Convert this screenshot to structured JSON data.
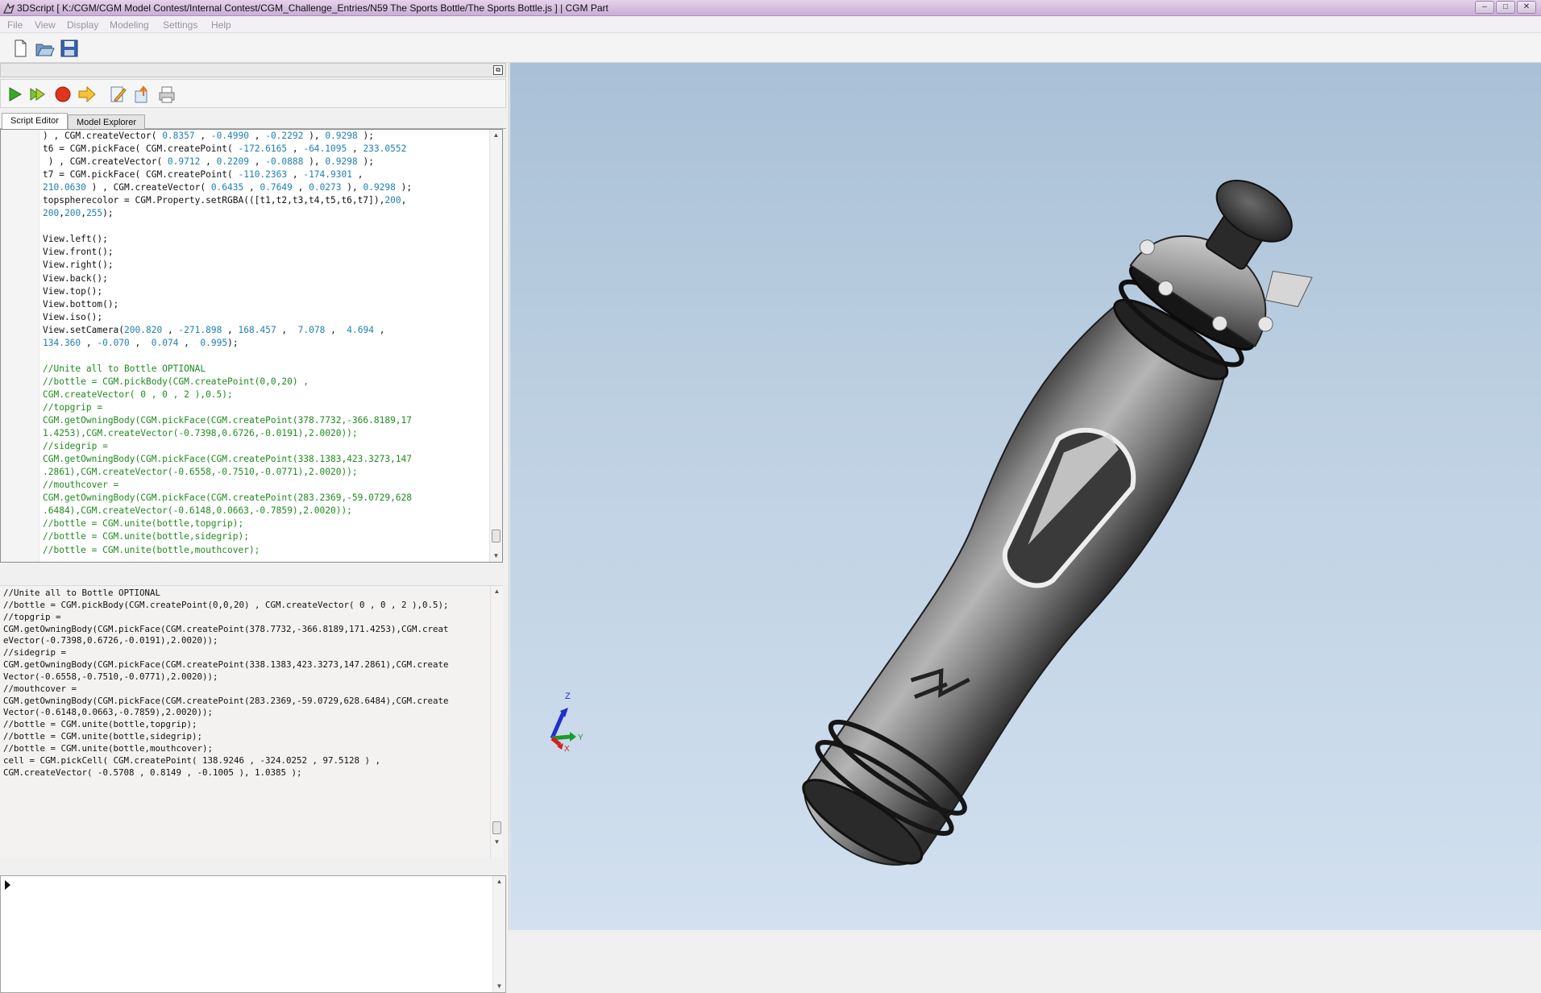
{
  "window": {
    "title": "3DScript [ K:/CGM/CGM Model Contest/Internal Contest/CGM_Challenge_Entries/N59 The Sports Bottle/The Sports Bottle.js ] | CGM Part",
    "buttons": [
      "–",
      "□",
      "✕"
    ]
  },
  "menu": [
    "File",
    "View",
    "Display",
    "Modeling",
    "Settings",
    "Help"
  ],
  "toolbar": {
    "icons": [
      "new-file-icon",
      "open-folder-icon",
      "save-icon"
    ]
  },
  "script_toolbar": {
    "icons": [
      "run-icon",
      "run-step-icon",
      "stop-icon",
      "forward-arrow-icon",
      "edit-script-icon",
      "export-icon",
      "print-icon"
    ]
  },
  "tabs": [
    "Script Editor",
    "Model Explorer"
  ],
  "editor_lines": [
    [
      [
        "k",
        ") , CGM.createVector( "
      ],
      [
        "n",
        "0.8357"
      ],
      [
        "k",
        " , "
      ],
      [
        "n",
        "-0.4990"
      ],
      [
        "k",
        " , "
      ],
      [
        "n",
        "-0.2292"
      ],
      [
        "k",
        " ), "
      ],
      [
        "n",
        "0.9298"
      ],
      [
        "k",
        " );"
      ]
    ],
    [
      [
        "k",
        "t6 = CGM.pickFace( CGM.createPoint( "
      ],
      [
        "n",
        "-172.6165"
      ],
      [
        "k",
        " , "
      ],
      [
        "n",
        "-64.1095"
      ],
      [
        "k",
        " , "
      ],
      [
        "n",
        "233.0552"
      ]
    ],
    [
      [
        "k",
        " ) , CGM.createVector( "
      ],
      [
        "n",
        "0.9712"
      ],
      [
        "k",
        " , "
      ],
      [
        "n",
        "0.2209"
      ],
      [
        "k",
        " , "
      ],
      [
        "n",
        "-0.0888"
      ],
      [
        "k",
        " ), "
      ],
      [
        "n",
        "0.9298"
      ],
      [
        "k",
        " );"
      ]
    ],
    [
      [
        "k",
        "t7 = CGM.pickFace( CGM.createPoint( "
      ],
      [
        "n",
        "-110.2363"
      ],
      [
        "k",
        " , "
      ],
      [
        "n",
        "-174.9301"
      ],
      [
        "k",
        " ,"
      ]
    ],
    [
      [
        "n",
        "210.0630"
      ],
      [
        "k",
        " ) , CGM.createVector( "
      ],
      [
        "n",
        "0.6435"
      ],
      [
        "k",
        " , "
      ],
      [
        "n",
        "0.7649"
      ],
      [
        "k",
        " , "
      ],
      [
        "n",
        "0.0273"
      ],
      [
        "k",
        " ), "
      ],
      [
        "n",
        "0.9298"
      ],
      [
        "k",
        " );"
      ]
    ],
    [
      [
        "k",
        "topspherecolor = CGM.Property.setRGBA(([t1,t2,t3,t4,t5,t6,t7]),"
      ],
      [
        "n",
        "200"
      ],
      [
        "k",
        ","
      ]
    ],
    [
      [
        "n",
        "200"
      ],
      [
        "k",
        ","
      ],
      [
        "n",
        "200"
      ],
      [
        "k",
        ","
      ],
      [
        "n",
        "255"
      ],
      [
        "k",
        ");"
      ]
    ],
    [
      [
        "k",
        ""
      ]
    ],
    [
      [
        "k",
        "View.left();"
      ]
    ],
    [
      [
        "k",
        "View.front();"
      ]
    ],
    [
      [
        "k",
        "View.right();"
      ]
    ],
    [
      [
        "k",
        "View.back();"
      ]
    ],
    [
      [
        "k",
        "View.top();"
      ]
    ],
    [
      [
        "k",
        "View.bottom();"
      ]
    ],
    [
      [
        "k",
        "View.iso();"
      ]
    ],
    [
      [
        "k",
        "View.setCamera("
      ],
      [
        "n",
        "200.820"
      ],
      [
        "k",
        " , "
      ],
      [
        "n",
        "-271.898"
      ],
      [
        "k",
        " , "
      ],
      [
        "n",
        "168.457"
      ],
      [
        "k",
        " ,  "
      ],
      [
        "n",
        "7.078"
      ],
      [
        "k",
        " ,  "
      ],
      [
        "n",
        "4.694"
      ],
      [
        "k",
        " ,"
      ]
    ],
    [
      [
        "n",
        "134.360"
      ],
      [
        "k",
        " , "
      ],
      [
        "n",
        "-0.070"
      ],
      [
        "k",
        " ,  "
      ],
      [
        "n",
        "0.074"
      ],
      [
        "k",
        " ,  "
      ],
      [
        "n",
        "0.995"
      ],
      [
        "k",
        ");"
      ]
    ],
    [
      [
        "k",
        ""
      ]
    ],
    [
      [
        "g",
        "//Unite all to Bottle OPTIONAL"
      ]
    ],
    [
      [
        "g",
        "//bottle = CGM.pickBody(CGM.createPoint(0,0,20) ,"
      ]
    ],
    [
      [
        "g",
        "CGM.createVector( 0 , 0 , 2 ),0.5);"
      ]
    ],
    [
      [
        "g",
        "//topgrip ="
      ]
    ],
    [
      [
        "g",
        "CGM.getOwningBody(CGM.pickFace(CGM.createPoint(378.7732,-366.8189,17"
      ]
    ],
    [
      [
        "g",
        "1.4253),CGM.createVector(-0.7398,0.6726,-0.0191),2.0020));"
      ]
    ],
    [
      [
        "g",
        "//sidegrip ="
      ]
    ],
    [
      [
        "g",
        "CGM.getOwningBody(CGM.pickFace(CGM.createPoint(338.1383,423.3273,147"
      ]
    ],
    [
      [
        "g",
        ".2861),CGM.createVector(-0.6558,-0.7510,-0.0771),2.0020));"
      ]
    ],
    [
      [
        "g",
        "//mouthcover ="
      ]
    ],
    [
      [
        "g",
        "CGM.getOwningBody(CGM.pickFace(CGM.createPoint(283.2369,-59.0729,628"
      ]
    ],
    [
      [
        "g",
        ".6484),CGM.createVector(-0.6148,0.0663,-0.7859),2.0020));"
      ]
    ],
    [
      [
        "g",
        "//bottle = CGM.unite(bottle,topgrip);"
      ]
    ],
    [
      [
        "g",
        "//bottle = CGM.unite(bottle,sidegrip);"
      ]
    ],
    [
      [
        "g",
        "//bottle = CGM.unite(bottle,mouthcover);"
      ]
    ]
  ],
  "console_lines": [
    "//Unite all to Bottle OPTIONAL",
    "//bottle = CGM.pickBody(CGM.createPoint(0,0,20) , CGM.createVector( 0 , 0 , 2 ),0.5);",
    "//topgrip =",
    "CGM.getOwningBody(CGM.pickFace(CGM.createPoint(378.7732,-366.8189,171.4253),CGM.creat",
    "eVector(-0.7398,0.6726,-0.0191),2.0020));",
    "//sidegrip =",
    "CGM.getOwningBody(CGM.pickFace(CGM.createPoint(338.1383,423.3273,147.2861),CGM.create",
    "Vector(-0.6558,-0.7510,-0.0771),2.0020));",
    "//mouthcover =",
    "CGM.getOwningBody(CGM.pickFace(CGM.createPoint(283.2369,-59.0729,628.6484),CGM.create",
    "Vector(-0.6148,0.0663,-0.7859),2.0020));",
    "//bottle = CGM.unite(bottle,topgrip);",
    "//bottle = CGM.unite(bottle,sidegrip);",
    "//bottle = CGM.unite(bottle,mouthcover);",
    "cell = CGM.pickCell( CGM.createPoint( 138.9246 , -324.0252 , 97.5128 ) ,",
    "CGM.createVector( -0.5708 , 0.8149 , -0.1005 ), 1.0385 );"
  ],
  "axes": {
    "z": "Z",
    "y": "Y",
    "x": "X",
    "z_color": "#2030c8",
    "y_color": "#1a9a2a",
    "x_color": "#d02020"
  },
  "colors": {
    "viewport_top": "#a9c0d6",
    "viewport_bottom": "#d2e0ef",
    "number": "#1d7fb2",
    "comment": "#1e8c1e"
  }
}
